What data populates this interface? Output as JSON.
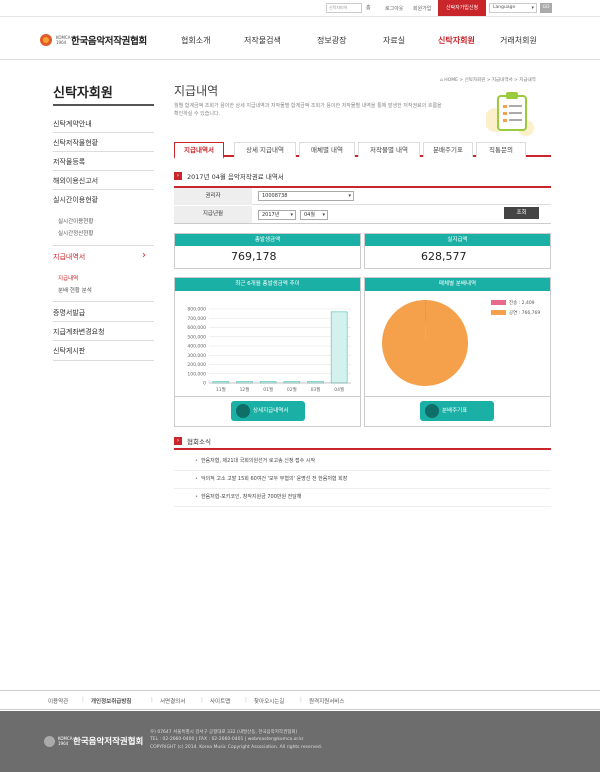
{
  "topbar": {
    "search_placeholder": "신탁자미어",
    "go": "홈",
    "util_links": [
      "로그아웃",
      "회원가입"
    ],
    "apply": "신탁자가입신청",
    "language": "Language",
    "lang_go": "GO"
  },
  "header": {
    "logo_small": "KOMCA 1964",
    "logo_name": "한국음악저작권협회",
    "nav": [
      "협회소개",
      "저작물검색",
      "정보광장",
      "자료실",
      "신탁자회원",
      "거래처회원"
    ],
    "active_nav": "신탁자회원"
  },
  "lnb": {
    "title": "신탁자회원",
    "items": [
      "신탁계약안내",
      "신탁저작물현황",
      "저작물등록",
      "해외이용신고서",
      "실시간이용현황"
    ],
    "sub_items_realtime": [
      "실시간이용현황",
      "실시간정산현황"
    ],
    "active_item": "지급내역서",
    "sub_items_payment": [
      "지급내역",
      "분배 현황 분석"
    ],
    "items_after": [
      "증명서발급",
      "지급계좌변경요청",
      "신탁게시판"
    ]
  },
  "content": {
    "title": "지급내역",
    "breadcrumb": "⌂ HOME > 신탁자회원 > 지급내역서 > 지급내역",
    "description": "월별 합계금액 조회가 용이한 상세 지급내역과 저작물별 합계금액 조회가 용이한 저작물별 내역을 통해 발생한 저작권료의 흐름을 확인하실 수 있습니다.",
    "tabs": [
      "지급내역서",
      "상세 지급내역",
      "매체별 내역",
      "저작물별 내역",
      "분배주기표",
      "직통문의"
    ],
    "active_tab": "지급내역서",
    "section_title": "2017년 04월 음악저작권료 내역서",
    "form": {
      "holder_label": "권리자",
      "holder_value": "10008738",
      "date_label": "지급년월",
      "year": "2017년",
      "month": "04월",
      "query_button": "조회"
    },
    "stats": {
      "total_label": "총발생금액",
      "total_value": "769,178",
      "actual_label": "실지급액",
      "actual_value": "628,577"
    },
    "trend_chart_title": "최근 6개월 총발생금액 추이",
    "pie_chart_title": "매체별 분배내역",
    "detail_button": "상세지급내역서",
    "cycle_button": "분배주기표",
    "news_title": "협회소식",
    "news": [
      "한음저협, 제21대 국회의원선거 로고송 신청 접수 시작",
      "악의적 고소 고발 15회 60여건 '모두 무혐의' 윤명선 전 한음저협 회장",
      "한음저협-포키코인, 창작지원금 700만원 전달해"
    ]
  },
  "chart_data": [
    {
      "type": "bar",
      "title": "최근 6개월 총발생금액 추이",
      "categories": [
        "11월",
        "12월",
        "01월",
        "02월",
        "03월",
        "04월"
      ],
      "values": [
        0,
        0,
        0,
        0,
        0,
        769178
      ],
      "ylim": [
        0,
        800000
      ],
      "yticks": [
        "0",
        "100,000",
        "200,000",
        "300,000",
        "400,000",
        "500,000",
        "600,000",
        "700,000",
        "800,000"
      ],
      "grid": true
    },
    {
      "type": "pie",
      "title": "매체별 분배내역",
      "legend_position": "top-right",
      "series": [
        {
          "name": "전송",
          "label": "전송 : 2,409",
          "value": 2409,
          "color": "#e96b8c"
        },
        {
          "name": "공연",
          "label": "공연 : 766,769",
          "value": 766769,
          "color": "#f5a04a"
        }
      ]
    }
  ],
  "footer": {
    "links": [
      "이용약관",
      "개인정보취급방침",
      "서면결의서",
      "사이트맵",
      "찾아오시는길",
      "원격지원서비스"
    ],
    "logo_name": "한국음악저작권협회",
    "address": "우) 07647 서울특별시 강서구 공항대로 332 (내발산동, 한국음악저작권협회)",
    "contact": "TEL : 02-2660-0400 | FAX : 02-2660-0401 | webmaster@komca.or.kr",
    "copyright": "COPYRIGHT (c) 2014. Korea Music Copyright Association. All rights reserved."
  }
}
